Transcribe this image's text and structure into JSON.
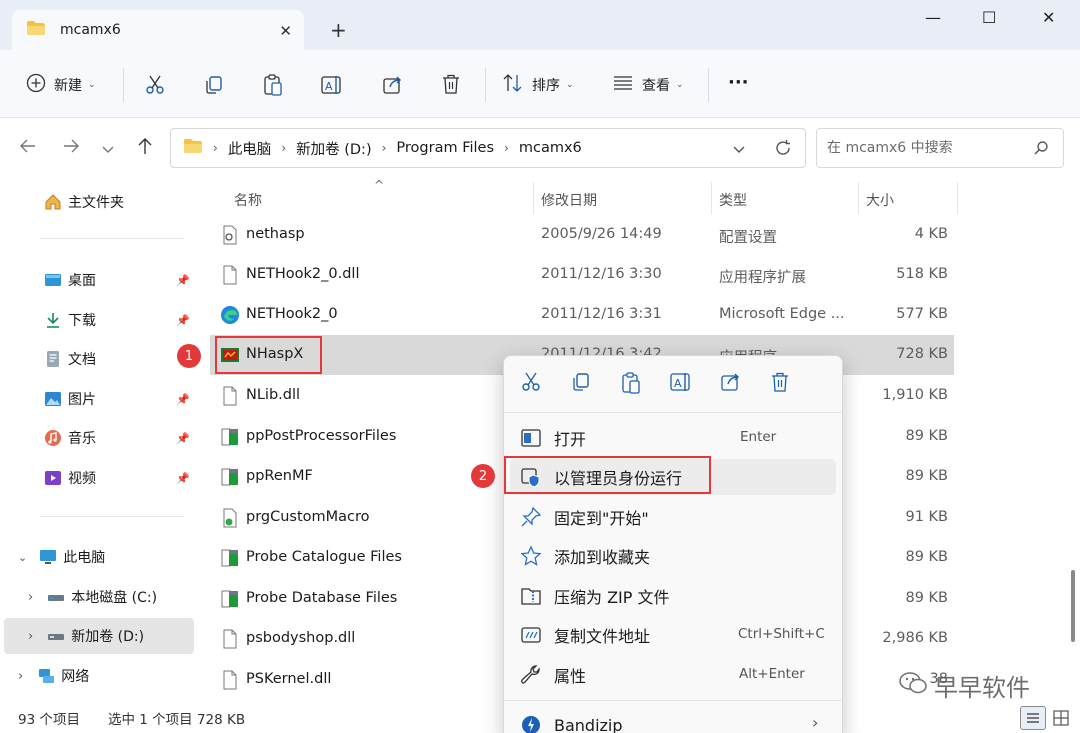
{
  "window": {
    "tab_title": "mcamx6",
    "close_tab": "✕",
    "new_tab": "+",
    "minimize": "—",
    "maximize": "☐",
    "close": "✕"
  },
  "toolbar": {
    "new_label": "新建",
    "sort_label": "排序",
    "view_label": "查看",
    "more_label": "···",
    "caret": "⌄"
  },
  "address": {
    "crumbs": [
      "此电脑",
      "新加卷 (D:)",
      "Program Files",
      "mcamx6"
    ],
    "separator": "›"
  },
  "search": {
    "placeholder": "在 mcamx6 中搜索"
  },
  "sidebar": {
    "home": "主文件夹",
    "quick_access": [
      "桌面",
      "下载",
      "文档",
      "图片",
      "音乐",
      "视频"
    ],
    "this_pc": "此电脑",
    "drives": [
      "本地磁盘 (C:)",
      "新加卷 (D:)"
    ],
    "network": "网络",
    "expander": "›",
    "expander_open": "⌄"
  },
  "columns": {
    "name": "名称",
    "date": "修改日期",
    "type": "类型",
    "size": "大小",
    "sort_indicator": "^"
  },
  "files": [
    {
      "name": "nethasp",
      "date": "2005/9/26 14:49",
      "type": "配置设置",
      "size": "4 KB",
      "icon": "config-file-icon"
    },
    {
      "name": "NETHook2_0.dll",
      "date": "2011/12/16 3:30",
      "type": "应用程序扩展",
      "size": "518 KB",
      "icon": "dll-file-icon"
    },
    {
      "name": "NETHook2_0",
      "date": "2011/12/16 3:31",
      "type": "Microsoft Edge ...",
      "size": "577 KB",
      "icon": "edge-icon"
    },
    {
      "name": "NHaspX",
      "date": "2011/12/16 3:42",
      "type": "应用程序",
      "size": "728 KB",
      "icon": "exe-icon"
    },
    {
      "name": "NLib.dll",
      "date": "",
      "type": "",
      "size": "1,910 KB",
      "icon": "dll-file-icon"
    },
    {
      "name": "ppPostProcessorFiles",
      "date": "",
      "type": "",
      "size": "89 KB",
      "icon": "archive-icon"
    },
    {
      "name": "ppRenMF",
      "date": "",
      "type": "",
      "size": "89 KB",
      "icon": "archive-icon"
    },
    {
      "name": "prgCustomMacro",
      "date": "",
      "type": "",
      "size": "91 KB",
      "icon": "script-icon"
    },
    {
      "name": "Probe Catalogue Files",
      "date": "",
      "type": "",
      "size": "89 KB",
      "icon": "archive-icon"
    },
    {
      "name": "Probe Database Files",
      "date": "",
      "type": "",
      "size": "89 KB",
      "icon": "archive-icon"
    },
    {
      "name": "psbodyshop.dll",
      "date": "",
      "type": "",
      "size": "2,986 KB",
      "icon": "dll-file-icon"
    },
    {
      "name": "PSKernel.dll",
      "date": "",
      "type": "",
      "size": "38",
      "icon": "dll-file-icon"
    }
  ],
  "status": {
    "count": "93 个项目",
    "selection": "选中 1 个项目  728 KB"
  },
  "context_menu": {
    "items": [
      {
        "label": "打开",
        "shortcut": "Enter",
        "icon": "open-icon"
      },
      {
        "label": "以管理员身份运行",
        "shortcut": "",
        "icon": "shield-icon"
      },
      {
        "label": "固定到\"开始\"",
        "shortcut": "",
        "icon": "pin-icon"
      },
      {
        "label": "添加到收藏夹",
        "shortcut": "",
        "icon": "star-icon"
      },
      {
        "label": "压缩为 ZIP 文件",
        "shortcut": "",
        "icon": "zip-icon"
      },
      {
        "label": "复制文件地址",
        "shortcut": "Ctrl+Shift+C",
        "icon": "copy-path-icon"
      },
      {
        "label": "属性",
        "shortcut": "Alt+Enter",
        "icon": "wrench-icon"
      },
      {
        "label": "Bandizip",
        "shortcut": "",
        "icon": "bandizip-icon"
      }
    ],
    "submenu_arrow": "›"
  },
  "annotations": {
    "badge1": "1",
    "badge2": "2"
  },
  "watermark": {
    "text": "早早软件"
  },
  "colors": {
    "accent": "#0067c0",
    "annotation_red": "#e23a3a",
    "selection_gray": "#d9d9d9"
  }
}
